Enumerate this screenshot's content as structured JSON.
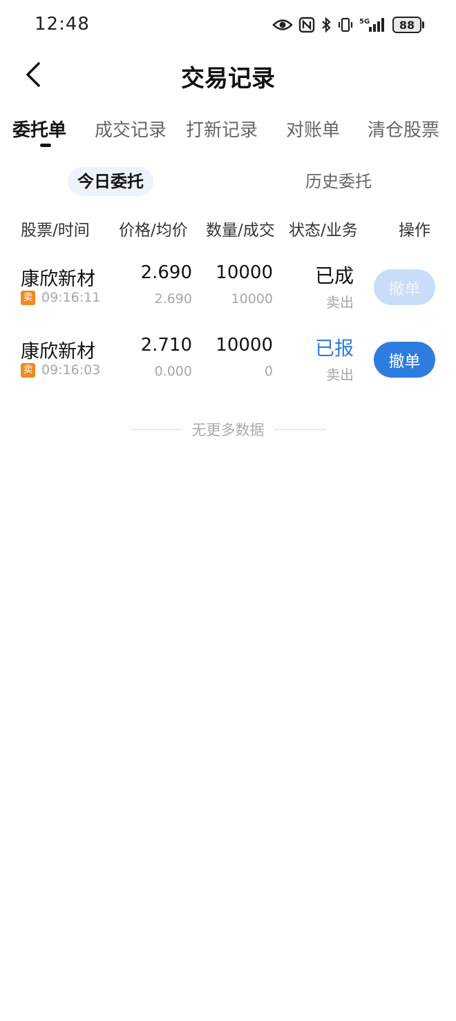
{
  "status_bar": {
    "time": "12:48",
    "icons": [
      "eye-icon",
      "nfc-icon",
      "bluetooth-icon",
      "vibrate-icon",
      "signal-5g-icon"
    ],
    "network": "5G",
    "battery": "88"
  },
  "header": {
    "title": "交易记录",
    "back_icon": "chevron-left-icon"
  },
  "main_tabs": [
    {
      "label": "委托单",
      "active": true
    },
    {
      "label": "成交记录",
      "active": false
    },
    {
      "label": "打新记录",
      "active": false
    },
    {
      "label": "对账单",
      "active": false
    },
    {
      "label": "清仓股票",
      "active": false
    }
  ],
  "sub_tabs": [
    {
      "label": "今日委托",
      "active": true
    },
    {
      "label": "历史委托",
      "active": false
    }
  ],
  "columns": [
    "股票/时间",
    "价格/均价",
    "数量/成交",
    "状态/业务",
    "操作"
  ],
  "orders": [
    {
      "stock": "康欣新材",
      "side": "卖",
      "time": "09:16:11",
      "price": "2.690",
      "avg_price": "2.690",
      "qty": "10000",
      "filled": "10000",
      "status": "已成",
      "biz": "卖出",
      "action": "撤单",
      "action_enabled": false
    },
    {
      "stock": "康欣新材",
      "side": "卖",
      "time": "09:16:03",
      "price": "2.710",
      "avg_price": "0.000",
      "qty": "10000",
      "filled": "0",
      "status": "已报",
      "biz": "卖出",
      "action": "撤单",
      "action_enabled": true
    }
  ],
  "footer": {
    "no_more": "无更多数据"
  },
  "colors": {
    "accent": "#2f7ce0",
    "accent_disabled": "#c9ddf8",
    "sell_badge": "#f08a1c",
    "secondary_text": "#a6a6a6"
  }
}
